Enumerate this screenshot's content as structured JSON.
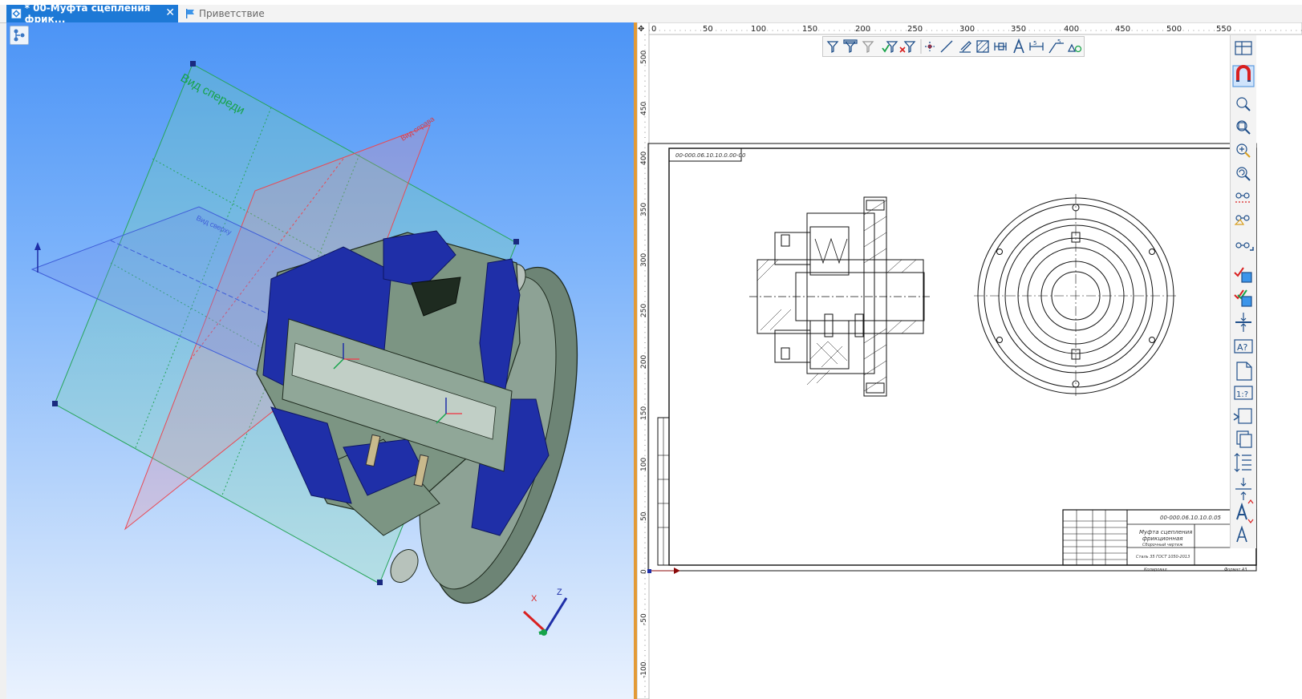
{
  "tabs": [
    {
      "label": "* 00-Муфта сцепления фрик...",
      "active": true
    },
    {
      "label": "Приветствие",
      "active": false
    }
  ],
  "view3d": {
    "plane_front_label": "Вид спереди",
    "plane_right_label": "Вид справа",
    "plane_top_label": "Вид сверху",
    "axis_x": "X",
    "axis_z": "Z"
  },
  "ruler": {
    "h_ticks": [
      "0",
      "50",
      "100",
      "150",
      "200",
      "250",
      "300",
      "350",
      "400",
      "450",
      "500",
      "550"
    ],
    "v_ticks": [
      "500",
      "450",
      "400",
      "350",
      "300",
      "250",
      "200",
      "150",
      "100",
      "50",
      "0",
      "-50",
      "-100"
    ]
  },
  "drawing": {
    "stamp_top_left": "00-000.06.10.10.0.00-00",
    "title_block": {
      "designation": "00-000.06.10.10.0.05",
      "name_line1": "Муфта сцепления",
      "name_line2": "фрикционная",
      "subtitle": "Сборочный чертеж",
      "material": "Сталь 35 ГОСТ 1050-2013",
      "copied": "Копировал",
      "format": "Формат А3"
    }
  },
  "toolbar2d_tools": [
    "filter-icon",
    "filter-icon",
    "filter-icon",
    "check-filter-icon",
    "clear-filter-icon",
    "point-icon",
    "line-icon",
    "pen-icon",
    "hatch-icon",
    "dimension-icon",
    "text-icon",
    "size-icon",
    "leader-icon",
    "shape-icon"
  ],
  "right_toolbar_tools": [
    "layers-icon",
    "magnet-icon",
    "zoom-in-icon",
    "zoom-window-icon",
    "zoom-all-icon",
    "zoom-prev-icon",
    "glasses-icon",
    "glasses-icon",
    "glasses-icon",
    "check-cube-icon",
    "check-cube-icon",
    "project-icon",
    "text-style-icon",
    "page-icon",
    "scale-icon",
    "insert-view-icon",
    "copy-icon",
    "spacing-icon",
    "align-icon",
    "font-size-icon",
    "font-icon"
  ],
  "colors": {
    "tab_active": "#1d79d6",
    "splitter": "#e39a36",
    "model_blue": "#1f2fa8",
    "model_green": "#7f9a86",
    "plane_green": "#27a55a",
    "plane_red": "#e84a55",
    "plane_blue": "#3f5ed8"
  }
}
